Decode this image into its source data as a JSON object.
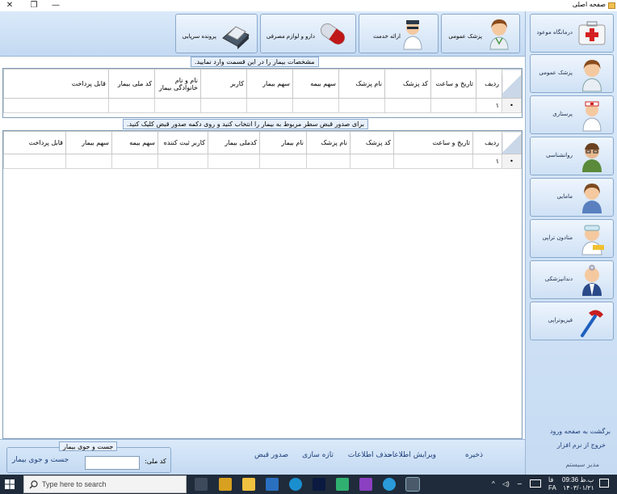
{
  "window": {
    "title": "صفحه اصلی",
    "controls": {
      "close": "✕",
      "restore": "❐",
      "minimize": "—"
    }
  },
  "toolbar": {
    "buttons": [
      {
        "label": "پزشک عمومی",
        "icon": "doctor-icon"
      },
      {
        "label": "ارائه خدمت",
        "icon": "nurse-icon"
      },
      {
        "label": "دارو و لوازم مصرفی",
        "icon": "pill-icon"
      },
      {
        "label": "پرونده سرپایی",
        "icon": "printer-icon"
      }
    ]
  },
  "patient_section": {
    "title": "مشخصات بیمار را در این قسمت وارد نمایید.",
    "columns": [
      "ردیف",
      "تاریخ و ساعت",
      "کد پزشک",
      "نام پزشک",
      "سهم بیمه",
      "سهم بیمار",
      "کاربر",
      "نام و نام خانوادگی بیمار",
      "کد ملی بیمار",
      "قابل پرداخت"
    ],
    "rows": [
      {
        "marker": "•",
        "values": [
          "۱",
          "",
          "",
          "",
          "",
          "",
          "",
          "",
          "",
          ""
        ]
      }
    ]
  },
  "receipt_section": {
    "title": "برای صدور قبض سطر مربوط به بیمار را انتخاب کنید و روی دکمه صدور قبض کلیک کنید.",
    "columns": [
      "ردیف",
      "تاریخ و ساعت",
      "کد پزشک",
      "نام پزشک",
      "نام بیمار",
      "کدملی بیمار",
      "کاربر ثبت کننده",
      "سهم بیمه",
      "سهم بیمار",
      "قابل پرداخت"
    ],
    "rows": [
      {
        "marker": "•",
        "values": [
          "۱",
          "",
          "",
          "",
          "",
          "",
          "",
          "",
          "",
          ""
        ]
      }
    ]
  },
  "actions": {
    "save": "ذخیره",
    "edit": "ویرایش اطلاعات",
    "delete": "حذف اطلاعات",
    "refresh": "تازه سازی",
    "issue_receipt": "صدور قبض"
  },
  "search": {
    "legend": "جست و جوی بیمار",
    "national_code_label": "کد ملی:",
    "national_code_value": "",
    "button": "جست و جوی بیمار"
  },
  "sidebar": {
    "items": [
      {
        "label": "درمانگاه موعود",
        "icon": "first-aid-icon"
      },
      {
        "label": "پزشک عمومی",
        "icon": "doctor-icon"
      },
      {
        "label": "پرستاری",
        "icon": "nurse-icon"
      },
      {
        "label": "روانشناسی",
        "icon": "psychology-icon"
      },
      {
        "label": "مامایی",
        "icon": "midwife-icon"
      },
      {
        "label": "متادون تراپی",
        "icon": "methadone-icon"
      },
      {
        "label": "دندانپزشکی",
        "icon": "dentist-icon"
      },
      {
        "label": "فیزیوتراپی",
        "icon": "reflex-hammer-icon"
      }
    ],
    "back_to_login": "برگشت به صفحه ورود",
    "exit": "خروج از نرم افزار",
    "user": "مدیر سیستم"
  },
  "taskbar": {
    "search_placeholder": "Type here to search",
    "time": "09:36 ب.ظ",
    "date": "۱۴۰۳/۰۱/۲۱",
    "language": "فا",
    "language_code": "FA"
  },
  "colors": {
    "panel": "#c3d9f2",
    "link": "#1d3e7a",
    "grid_border": "#7f9db9",
    "empty_area": "#ababab",
    "taskbar": "#1f2b3a"
  }
}
